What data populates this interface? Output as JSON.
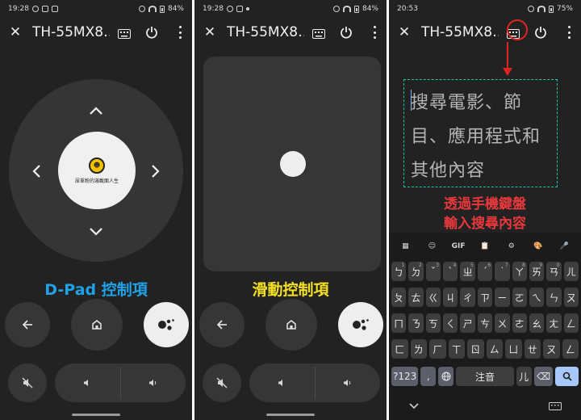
{
  "screens": [
    {
      "status": {
        "time": "19:28",
        "battery": "84%"
      },
      "appbar": {
        "title": "TH-55MX8…",
        "close": "✕"
      },
      "dpad": {
        "logo_mark": "☻",
        "logo_text": "尿單粉的滿載面人生"
      },
      "caption": "D-Pad 控制項"
    },
    {
      "status": {
        "time": "19:28",
        "battery": "84%"
      },
      "appbar": {
        "title": "TH-55MX8…",
        "close": "✕"
      },
      "caption": "滑動控制項"
    },
    {
      "status": {
        "time": "20:53",
        "battery": "75%"
      },
      "appbar": {
        "title": "TH-55MX8…",
        "close": "✕"
      },
      "search_placeholder": [
        "搜尋電影、節",
        "目、應用程式和",
        "其他內容"
      ],
      "note": [
        "透過手機鍵盤",
        "輸入搜尋內容"
      ],
      "keyboard": {
        "toolbar": [
          "▦",
          "☺",
          "GIF",
          "📋",
          "⚙",
          "🎨",
          "🎤"
        ],
        "row1": [
          {
            "k": "ㄅ",
            "s": "1"
          },
          {
            "k": "ㄉ",
            "s": "2"
          },
          {
            "k": "ˇ",
            "s": "3"
          },
          {
            "k": "ˋ",
            "s": "4"
          },
          {
            "k": "ㄓ",
            "s": "5"
          },
          {
            "k": "ˊ",
            "s": "6"
          },
          {
            "k": "˙",
            "s": "7"
          },
          {
            "k": "ㄚ",
            "s": "8"
          },
          {
            "k": "ㄞ",
            "s": "9"
          },
          {
            "k": "ㄢ",
            "s": "0"
          },
          {
            "k": "ㄦ",
            "s": ""
          }
        ],
        "row2": [
          "ㄆ",
          "ㄊ",
          "ㄍ",
          "ㄐ",
          "ㄔ",
          "ㄗ",
          "ㄧ",
          "ㄛ",
          "ㄟ",
          "ㄣ",
          "ㄡ"
        ],
        "row3": [
          "ㄇ",
          "ㄋ",
          "ㄎ",
          "ㄑ",
          "ㄕ",
          "ㄘ",
          "ㄨ",
          "ㄜ",
          "ㄠ",
          "ㄤ",
          "ㄥ"
        ],
        "row4": [
          "ㄈ",
          "ㄌ",
          "ㄏ",
          "ㄒ",
          "ㄖ",
          "ㄙ",
          "ㄩ",
          "ㄝ",
          "ㄡ",
          "ㄥ"
        ],
        "bottom": {
          "symbols": "?123",
          "comma": ",",
          "space": "注音",
          "er": "儿",
          "backspace": "⌫"
        }
      }
    }
  ]
}
